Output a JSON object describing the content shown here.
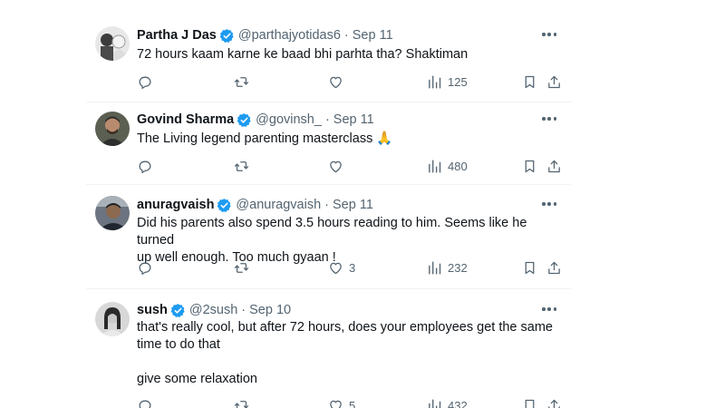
{
  "tweets": [
    {
      "name": "Partha J Das",
      "handle": "@parthajyotidas6",
      "separator": "·",
      "date": "Sep 11",
      "text": "72 hours kaam karne ke baad bhi parhta tha? Shaktiman",
      "replies": "",
      "reposts": "",
      "likes": "",
      "views": "125"
    },
    {
      "name": "Govind Sharma",
      "handle": "@govinsh_",
      "separator": "·",
      "date": "Sep 11",
      "text": "The Living legend parenting masterclass 🙏",
      "replies": "",
      "reposts": "",
      "likes": "",
      "views": "480"
    },
    {
      "name": "anuragvaish",
      "handle": "@anuragvaish",
      "separator": "·",
      "date": "Sep 11",
      "text": "Did his parents also spend 3.5 hours reading to him. Seems like he turned\nup well enough. Too much gyaan !",
      "replies": "",
      "reposts": "",
      "likes": "3",
      "views": "232"
    },
    {
      "name": "sush",
      "handle": "@2sush",
      "separator": "·",
      "date": "Sep 10",
      "text": "that's really cool, but after 72 hours, does your employees get the same\ntime to do that\n\ngive some relaxation",
      "replies": "",
      "reposts": "",
      "likes": "5",
      "views": "432"
    }
  ],
  "icons": {
    "verified": "verified-badge-icon",
    "reply": "reply-icon",
    "repost": "repost-icon",
    "like": "like-icon",
    "views": "views-icon",
    "bookmark": "bookmark-icon",
    "share": "share-icon",
    "more": "more-icon"
  },
  "colors": {
    "verified_blue": "#1d9bf0",
    "text_primary": "#0f1419",
    "text_secondary": "#536471",
    "divider": "#eff3f4"
  }
}
